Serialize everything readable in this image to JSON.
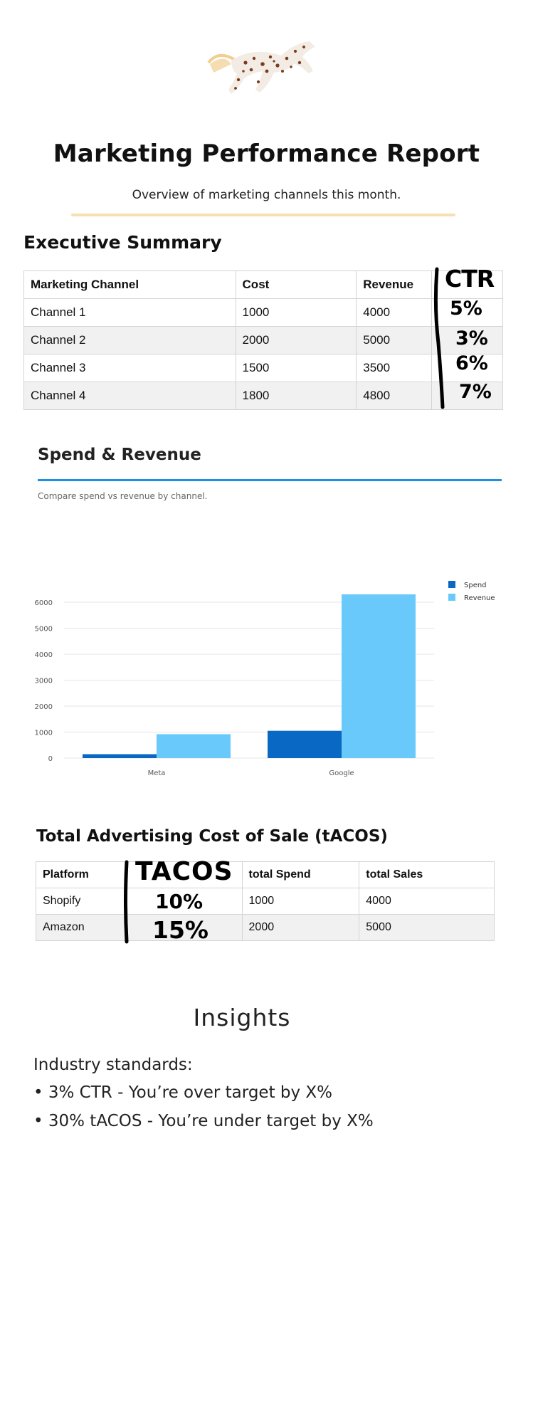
{
  "header": {
    "title": "Marketing Performance Report",
    "subtitle": "Overview of marketing channels this month."
  },
  "executive_summary": {
    "heading": "Executive Summary",
    "columns": [
      "Marketing Channel",
      "Cost",
      "Revenue"
    ],
    "rows": [
      [
        "Channel 1",
        "1000",
        "4000"
      ],
      [
        "Channel 2",
        "2000",
        "5000"
      ],
      [
        "Channel 3",
        "1500",
        "3500"
      ],
      [
        "Channel 4",
        "1800",
        "4800"
      ]
    ],
    "handwritten": {
      "header": "CTR",
      "values": [
        "5%",
        "3%",
        "6%",
        "7%"
      ]
    }
  },
  "spend_revenue": {
    "heading": "Spend & Revenue",
    "description": "Compare spend vs revenue by channel."
  },
  "chart_data": {
    "type": "bar",
    "categories": [
      "Meta",
      "Google"
    ],
    "series": [
      {
        "name": "Spend",
        "values": [
          150,
          1050
        ],
        "color": "#0868c4"
      },
      {
        "name": "Revenue",
        "values": [
          920,
          6300
        ],
        "color": "#69c9fb"
      }
    ],
    "ylim": [
      0,
      6300
    ],
    "yticks": [
      "0",
      "1000",
      "2000",
      "3000",
      "4000",
      "5000",
      "6000"
    ],
    "grid": true,
    "legend": "top-right"
  },
  "tacos": {
    "heading": "Total Advertising Cost of Sale (tACOS)",
    "columns": [
      "Platform",
      "TACOS",
      "total Spend",
      "total Sales"
    ],
    "rows": [
      [
        "Shopify",
        "10%",
        "1000",
        "4000"
      ],
      [
        "Amazon",
        "15%",
        "2000",
        "5000"
      ]
    ]
  },
  "insights": {
    "heading": "Insights",
    "lines": [
      "Industry standards:",
      "• 3% CTR - You’re over target by X%",
      "• 30% tACOS - You’re under target by X%"
    ]
  },
  "colors": {
    "gold_rule": "#f6dfb0",
    "blue_rule": "#1f8fe0",
    "spend": "#0868c4",
    "revenue": "#69c9fb"
  }
}
